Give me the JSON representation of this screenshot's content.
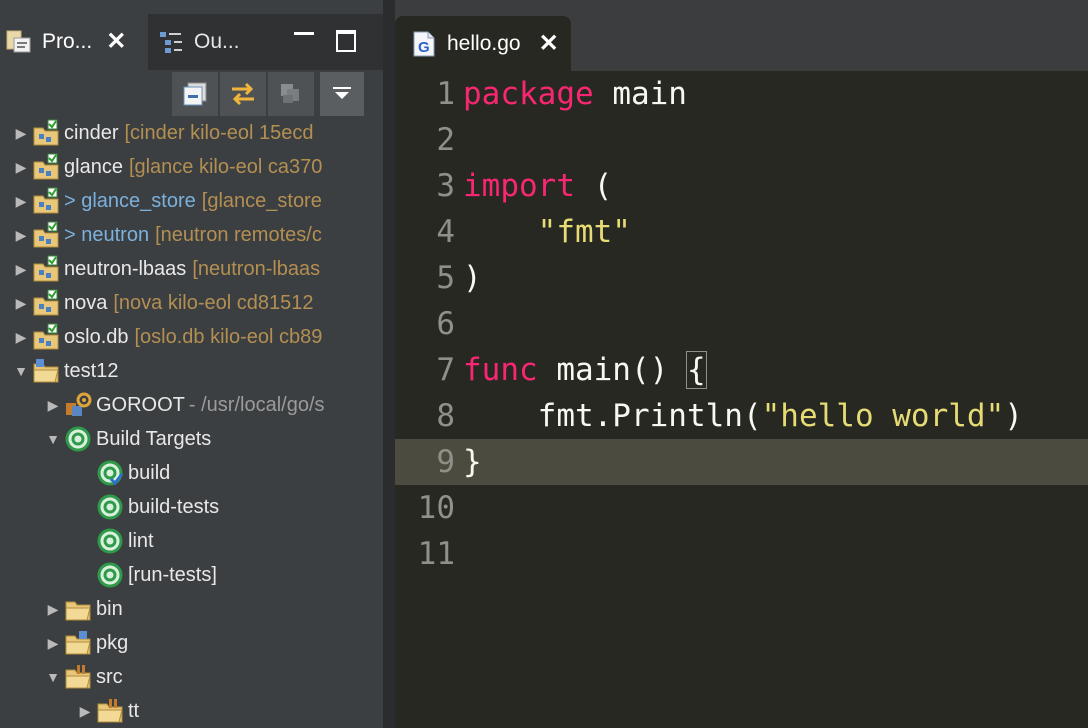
{
  "left_panel": {
    "tabs": [
      {
        "label": "Pro...",
        "icon": "project-explorer-icon",
        "active": true
      },
      {
        "label": "Ou...",
        "icon": "outline-icon",
        "active": false
      }
    ],
    "close_glyph": "✕",
    "toolbar": [
      "collapse-all-icon",
      "link-editor-icon",
      "filter-icon",
      "view-menu-icon"
    ],
    "tree": [
      {
        "label": "cinder",
        "decoration": "[cinder kilo-eol 15ecd"
      },
      {
        "label": "glance",
        "decoration": "[glance kilo-eol ca370"
      },
      {
        "label": "> glance_store",
        "decoration": "[glance_store"
      },
      {
        "label": "> neutron",
        "decoration": "[neutron remotes/c"
      },
      {
        "label": "neutron-lbaas",
        "decoration": "[neutron-lbaas"
      },
      {
        "label": "nova",
        "decoration": "[nova kilo-eol cd81512"
      },
      {
        "label": "oslo.db",
        "decoration": "[oslo.db kilo-eol cb89"
      },
      {
        "label": "test12"
      },
      {
        "label": "GOROOT",
        "decoration": "- /usr/local/go/s"
      },
      {
        "label": "Build Targets"
      },
      {
        "label": "build"
      },
      {
        "label": "build-tests"
      },
      {
        "label": "lint"
      },
      {
        "label": "[run-tests]"
      },
      {
        "label": "bin"
      },
      {
        "label": "pkg"
      },
      {
        "label": "src"
      },
      {
        "label": "tt"
      }
    ]
  },
  "editor": {
    "tab": {
      "label": "hello.go",
      "icon": "go-file-icon"
    },
    "line_numbers": [
      "1",
      "2",
      "3",
      "4",
      "5",
      "6",
      "7",
      "8",
      "9",
      "10",
      "11"
    ],
    "code": {
      "l1_kw": "package",
      "l1_rest": " main",
      "l3_kw": "import",
      "l3_rest": " (",
      "l4_str": "\"fmt\"",
      "l5": ")",
      "l7_kw": "func",
      "l7_rest": " main() ",
      "l7_brace": "{",
      "l8_pre": "fmt.Println(",
      "l8_str": "\"hello world\"",
      "l8_post": ")",
      "l9": "}"
    },
    "highlighted_line": 9
  },
  "colors": {
    "keyword": "#f92672",
    "string": "#e6db74",
    "editor_bg": "#272822",
    "git_decoration": "#b38f52"
  }
}
